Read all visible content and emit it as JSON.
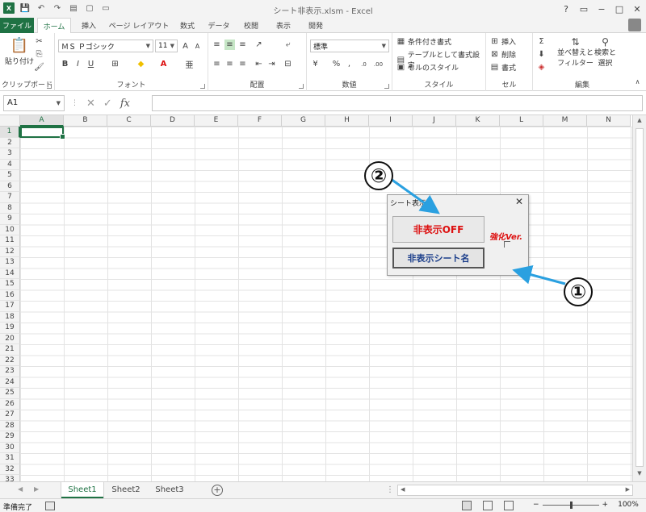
{
  "window": {
    "title": "シート非表示.xlsm - Excel"
  },
  "qat": {
    "save": "💾",
    "undo": "↶",
    "redo": "↷"
  },
  "ribbon_tabs": [
    "ファイル",
    "ホーム",
    "挿入",
    "ページ レイアウト",
    "数式",
    "データ",
    "校閲",
    "表示",
    "開発"
  ],
  "ribbon": {
    "clipboard": {
      "label": "クリップボード",
      "paste": "貼り付け"
    },
    "font": {
      "label": "フォント",
      "name": "ＭＳ Ｐゴシック",
      "size": "11",
      "grow": "A",
      "shrink": "A",
      "bold": "B",
      "italic": "I",
      "underline": "U"
    },
    "alignment": {
      "label": "配置"
    },
    "number": {
      "label": "数値",
      "format": "標準"
    },
    "styles": {
      "label": "スタイル",
      "conditional": "条件付き書式",
      "table": "テーブルとして書式設定",
      "cell_styles": "セルのスタイル"
    },
    "cells": {
      "label": "セル",
      "insert": "挿入",
      "delete": "削除",
      "format": "書式"
    },
    "editing": {
      "label": "編集",
      "sort": "並べ替えと",
      "sort2": "フィルター",
      "find": "検索と",
      "find2": "選択"
    }
  },
  "formula_bar": {
    "name_box": "A1",
    "fx": "fx",
    "value": ""
  },
  "columns": [
    "A",
    "B",
    "C",
    "D",
    "E",
    "F",
    "G",
    "H",
    "I",
    "J",
    "K",
    "L",
    "M",
    "N"
  ],
  "rows": [
    "1",
    "2",
    "3",
    "4",
    "5",
    "6",
    "7",
    "8",
    "9",
    "10",
    "11",
    "12",
    "13",
    "14",
    "15",
    "16",
    "17",
    "18",
    "19",
    "20",
    "21",
    "22",
    "23",
    "24",
    "25",
    "26",
    "27",
    "28",
    "29",
    "30",
    "31",
    "32",
    "33"
  ],
  "sheets": [
    "Sheet1",
    "Sheet2",
    "Sheet3"
  ],
  "status": {
    "ready": "準備完了",
    "zoom": "100%"
  },
  "dialog": {
    "title": "シート表示",
    "close": "✕",
    "toggle_button": "非表示OFF",
    "list_button": "非表示シート名",
    "enhanced_label": "強化Ver."
  },
  "callouts": {
    "one": "①",
    "two": "②"
  }
}
